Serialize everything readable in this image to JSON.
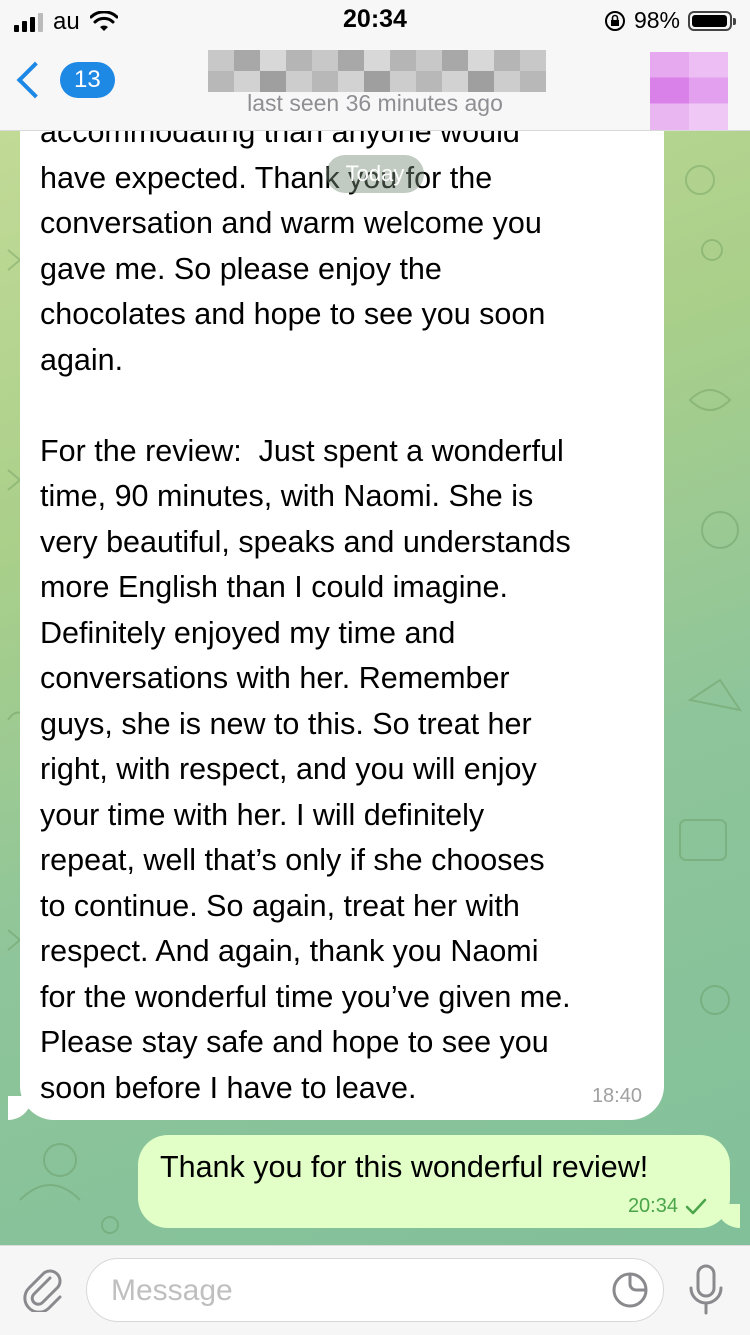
{
  "status_bar": {
    "carrier": "au",
    "time": "20:34",
    "battery": "98%",
    "battery_level": 0.98
  },
  "header": {
    "unread_count": "13",
    "last_seen": "last seen 36 minutes ago"
  },
  "date_chip": "Today",
  "messages": [
    {
      "direction": "incoming",
      "text": "accommodating than anyone would\nhave expected. Thank you for the\nconversation and warm welcome you\ngave me. So please enjoy the\nchocolates and hope to see you soon\nagain.\n\nFor the review:  Just spent a wonderful\ntime, 90 minutes, with Naomi. She is\nvery beautiful, speaks and understands\nmore English than I could imagine.\nDefinitely enjoyed my time and\nconversations with her. Remember\nguys, she is new to this. So treat her\nright, with respect, and you will enjoy\nyour time with her. I will definitely\nrepeat, well that’s only if she chooses\nto continue. So again, treat her with\nrespect. And again, thank you Naomi\nfor the wonderful time you’ve given me.\nPlease stay safe and hope to see you\nsoon before I have to leave.",
      "time": "18:40"
    },
    {
      "direction": "outgoing",
      "text": "Thank you for this wonderful review!",
      "time": "20:34",
      "status": "read-check"
    }
  ],
  "input": {
    "placeholder": "Message",
    "icons": [
      "paperclip-icon",
      "sticker-icon",
      "microphone-icon"
    ]
  },
  "colors": {
    "accent": "#1e88e5",
    "outgoing_bubble": "#e1ffc7",
    "read_check": "#4aa54a"
  }
}
